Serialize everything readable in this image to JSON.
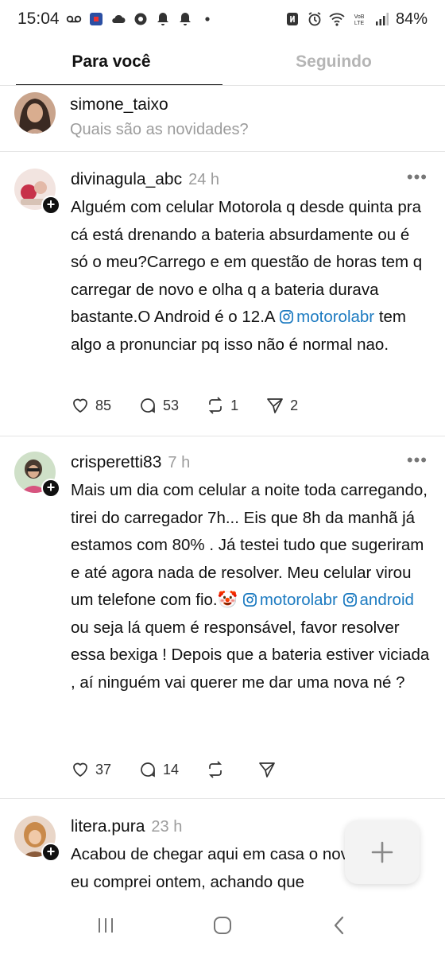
{
  "status_bar": {
    "time": "15:04",
    "battery": "84%",
    "left_icons": [
      "voicemail-icon",
      "app-notification-icon",
      "cloud-icon",
      "gear-notification-icon",
      "bell-icon",
      "bell-icon",
      "dot-icon"
    ],
    "right_icons": [
      "nfc-icon",
      "alarm-icon",
      "wifi-icon",
      "volte-icon",
      "signal-icon"
    ]
  },
  "tabs": [
    {
      "label": "Para você",
      "active": true
    },
    {
      "label": "Seguindo",
      "active": false
    }
  ],
  "composer": {
    "username": "simone_taixo",
    "placeholder": "Quais são as novidades?"
  },
  "posts": [
    {
      "username": "divinagula_abc",
      "time": "24 h",
      "body_parts": [
        {
          "text": "Alguém com celular Motorola q desde quinta pra cá está drenando a bateria absurdamente ou é só o meu?Carrego e em questão de horas tem q carregar de novo e olha q a bateria durava bastante.O Android é o 12.A "
        },
        {
          "mention": "motorolabr"
        },
        {
          "text": "  tem algo a pronunciar pq isso não é normal nao."
        }
      ],
      "likes": "85",
      "replies": "53",
      "reposts": "1",
      "shares": "2"
    },
    {
      "username": "crisperetti83",
      "time": "7 h",
      "body_parts": [
        {
          "text": "Mais um dia com celular a noite toda carregando, tirei do carregador 7h... Eis que 8h da manhã já estamos com 80% . Já testei tudo que sugeriram e até agora nada de resolver. Meu celular virou um telefone com fio.🤡 "
        },
        {
          "mention": "motorolabr"
        },
        {
          "text": " "
        },
        {
          "mention": "android"
        },
        {
          "text": " ou seja lá quem é responsável, favor resolver essa bexiga ! Depois que a bateria estiver viciada , aí ninguém vai querer me dar uma nova né ?"
        }
      ],
      "likes": "37",
      "replies": "14",
      "reposts": "",
      "shares": ""
    },
    {
      "username": "litera.pura",
      "time": "23 h",
      "body_parts": [
        {
          "text": "Acabou de chegar aqui em casa o novo que eu comprei ontem, achando que"
        }
      ]
    }
  ],
  "colors": {
    "mention": "#1d7bc1",
    "muted": "#9c9c9c",
    "text": "#111111"
  }
}
